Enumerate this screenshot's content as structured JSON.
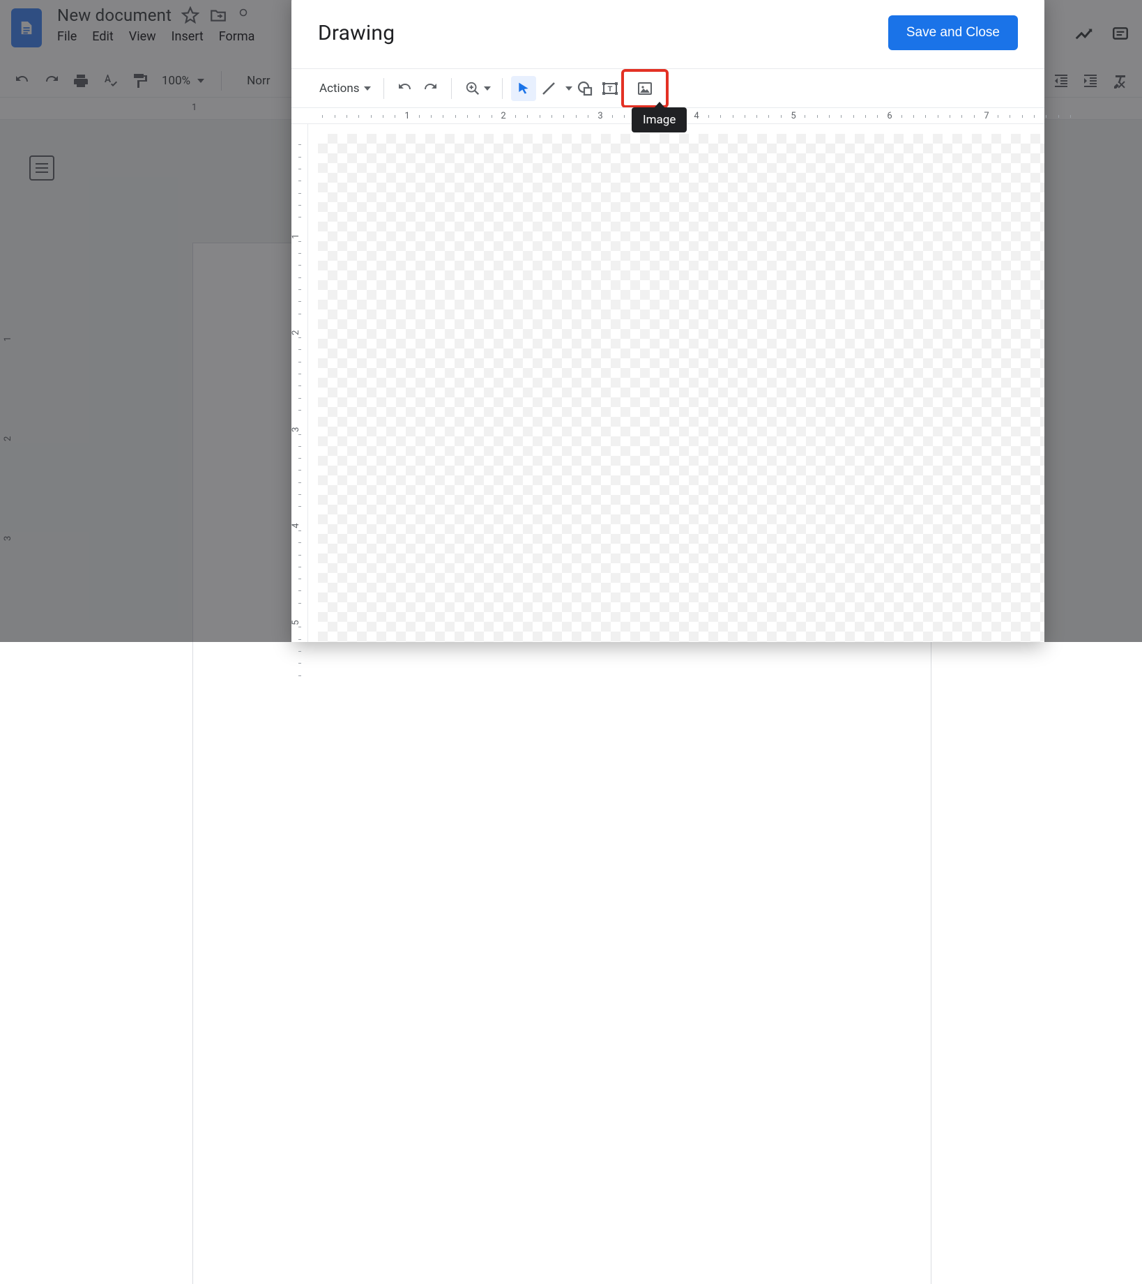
{
  "docs": {
    "title": "New document",
    "menus": [
      "File",
      "Edit",
      "View",
      "Insert",
      "Forma"
    ],
    "zoom": "100%",
    "styleLabel": "Norr",
    "rulerMarks": [
      1
    ],
    "leftRulerMarks": [
      1,
      2,
      3
    ]
  },
  "modal": {
    "title": "Drawing",
    "save": "Save and Close",
    "actions": "Actions",
    "tooltip": "Image",
    "hRulerMarks": [
      1,
      2,
      3,
      4,
      5,
      6,
      7
    ],
    "vRulerMarks": [
      1,
      2,
      3,
      4,
      5
    ]
  }
}
